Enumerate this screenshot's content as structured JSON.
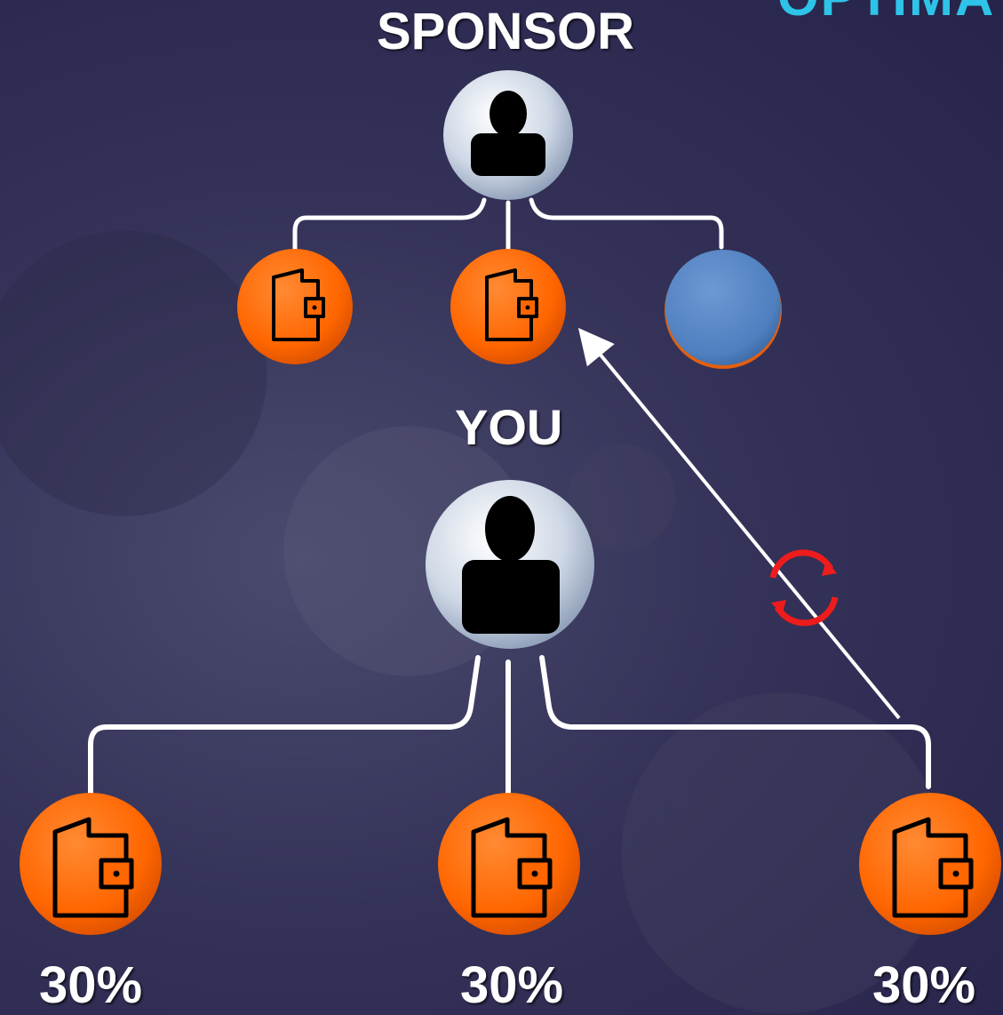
{
  "header": {
    "corner_fragment": "OPTIMA"
  },
  "labels": {
    "sponsor": "SPONSOR",
    "you": "YOU",
    "percent_left": "30%",
    "percent_center": "30%",
    "percent_right": "30%"
  },
  "icons": {
    "person": "person-icon",
    "wallet": "wallet-icon",
    "cycle": "refresh-cycle-icon"
  },
  "colors": {
    "orange_node": "#ff6600",
    "blue_node": "#4f7fbf",
    "person_circle": "#cfd8e6",
    "connector": "#ffffff",
    "cycle_arrows": "#ee1c1c"
  }
}
